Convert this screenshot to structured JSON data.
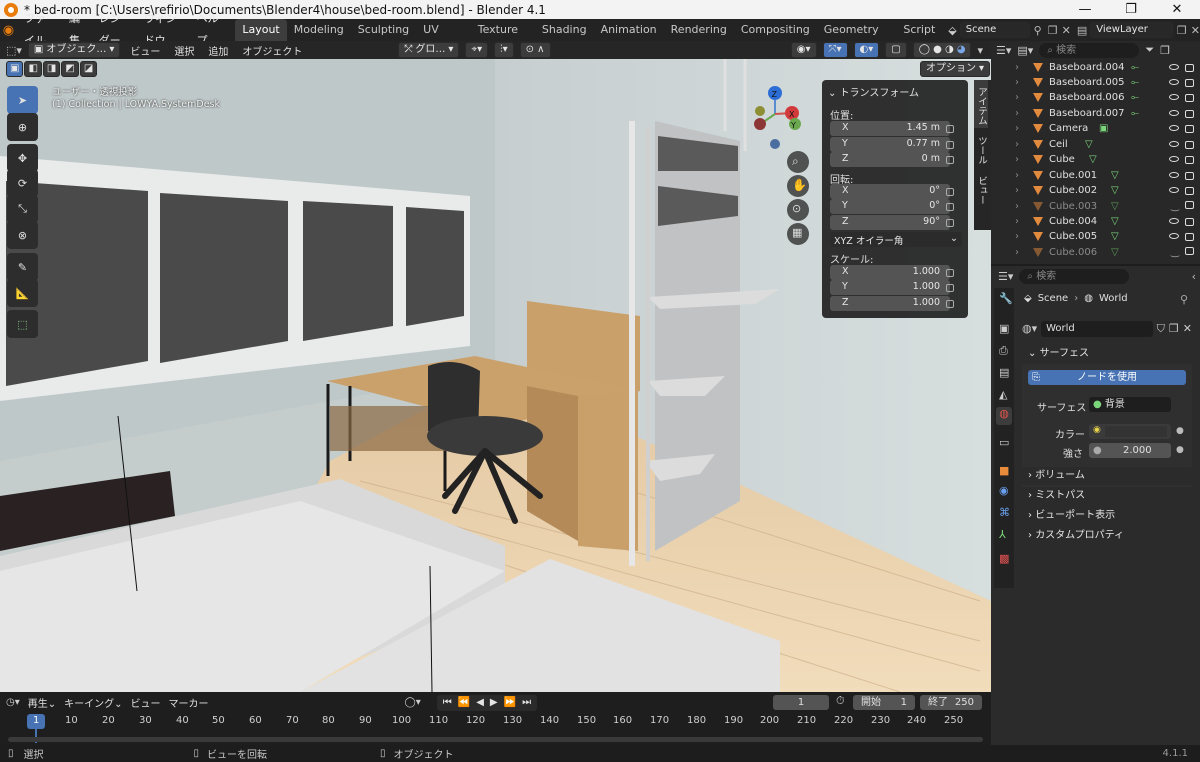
{
  "title": "* bed-room [C:\\Users\\refirio\\Documents\\Blender4\\house\\bed-room.blend] - Blender 4.1",
  "menus": [
    "ファイル",
    "編集",
    "レンダー",
    "ウィンドウ",
    "ヘルプ"
  ],
  "workspaces": [
    "Layout",
    "Modeling",
    "Sculpting",
    "UV Editing",
    "Texture Paint",
    "Shading",
    "Animation",
    "Rendering",
    "Compositing",
    "Geometry Nodes",
    "Script"
  ],
  "scene": "Scene",
  "view_layer": "ViewLayer",
  "viewport_header": {
    "mode": "オブジェク…",
    "menus": [
      "ビュー",
      "選択",
      "追加",
      "オブジェクト"
    ],
    "orientation": "グロ…",
    "options": "オプション"
  },
  "viewport_info": {
    "line1": "ユーザー・透視投影",
    "line2": "(1) Collection | LOWYA.SystemDesk"
  },
  "side_tabs": [
    "アイテム",
    "ツール",
    "ビュー"
  ],
  "transform": {
    "header": "トランスフォーム",
    "location_label": "位置:",
    "location": [
      {
        "axis": "X",
        "value": "1.45 m"
      },
      {
        "axis": "Y",
        "value": "0.77 m"
      },
      {
        "axis": "Z",
        "value": "0 m"
      }
    ],
    "rotation_label": "回転:",
    "rotation": [
      {
        "axis": "X",
        "value": "0°"
      },
      {
        "axis": "Y",
        "value": "0°"
      },
      {
        "axis": "Z",
        "value": "90°"
      }
    ],
    "rotation_mode": "XYZ オイラー角",
    "scale_label": "スケール:",
    "scale": [
      {
        "axis": "X",
        "value": "1.000"
      },
      {
        "axis": "Y",
        "value": "1.000"
      },
      {
        "axis": "Z",
        "value": "1.000"
      }
    ]
  },
  "outliner": {
    "search_placeholder": "検索",
    "items": [
      "Baseboard.004",
      "Baseboard.005",
      "Baseboard.006",
      "Baseboard.007",
      "Camera",
      "Ceil",
      "Cube",
      "Cube.001",
      "Cube.002",
      "Cube.003",
      "Cube.004",
      "Cube.005",
      "Cube.006"
    ]
  },
  "properties": {
    "search_placeholder": "検索",
    "breadcrumb_scene": "Scene",
    "breadcrumb_world": "World",
    "world_name": "World",
    "surface_header": "サーフェス",
    "use_nodes": "ノードを使用",
    "surface_label": "サーフェス",
    "surface_value": "背景",
    "color_label": "カラー",
    "strength_label": "強さ",
    "strength_value": "2.000",
    "panels": [
      "ボリューム",
      "ミストパス",
      "ビューポート表示",
      "カスタムプロパティ"
    ]
  },
  "timeline": {
    "menus": [
      "再生",
      "キーイング",
      "ビュー",
      "マーカー"
    ],
    "current_frame": "1",
    "start_label": "開始",
    "start": "1",
    "end_label": "終了",
    "end": "250",
    "ticks": [
      "1",
      "10",
      "20",
      "30",
      "40",
      "50",
      "60",
      "70",
      "80",
      "90",
      "100",
      "110",
      "120",
      "130",
      "140",
      "150",
      "160",
      "170",
      "180",
      "190",
      "200",
      "210",
      "220",
      "230",
      "240",
      "250"
    ]
  },
  "status": {
    "select": "選択",
    "rotate": "ビューを回転",
    "object": "オブジェクト",
    "version": "4.1.1"
  }
}
